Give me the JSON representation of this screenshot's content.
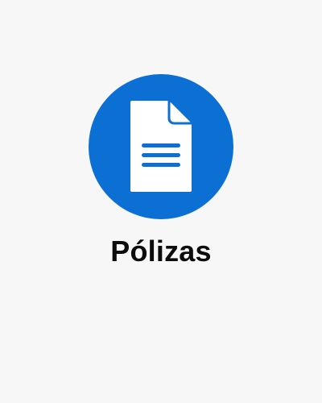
{
  "tile": {
    "title": "Pólizas",
    "icon": "document-icon"
  },
  "colors": {
    "background": "#f7f7f7",
    "accent": "#0b6fd3",
    "icon_fill": "#ffffff",
    "text": "#0c0c0c"
  }
}
